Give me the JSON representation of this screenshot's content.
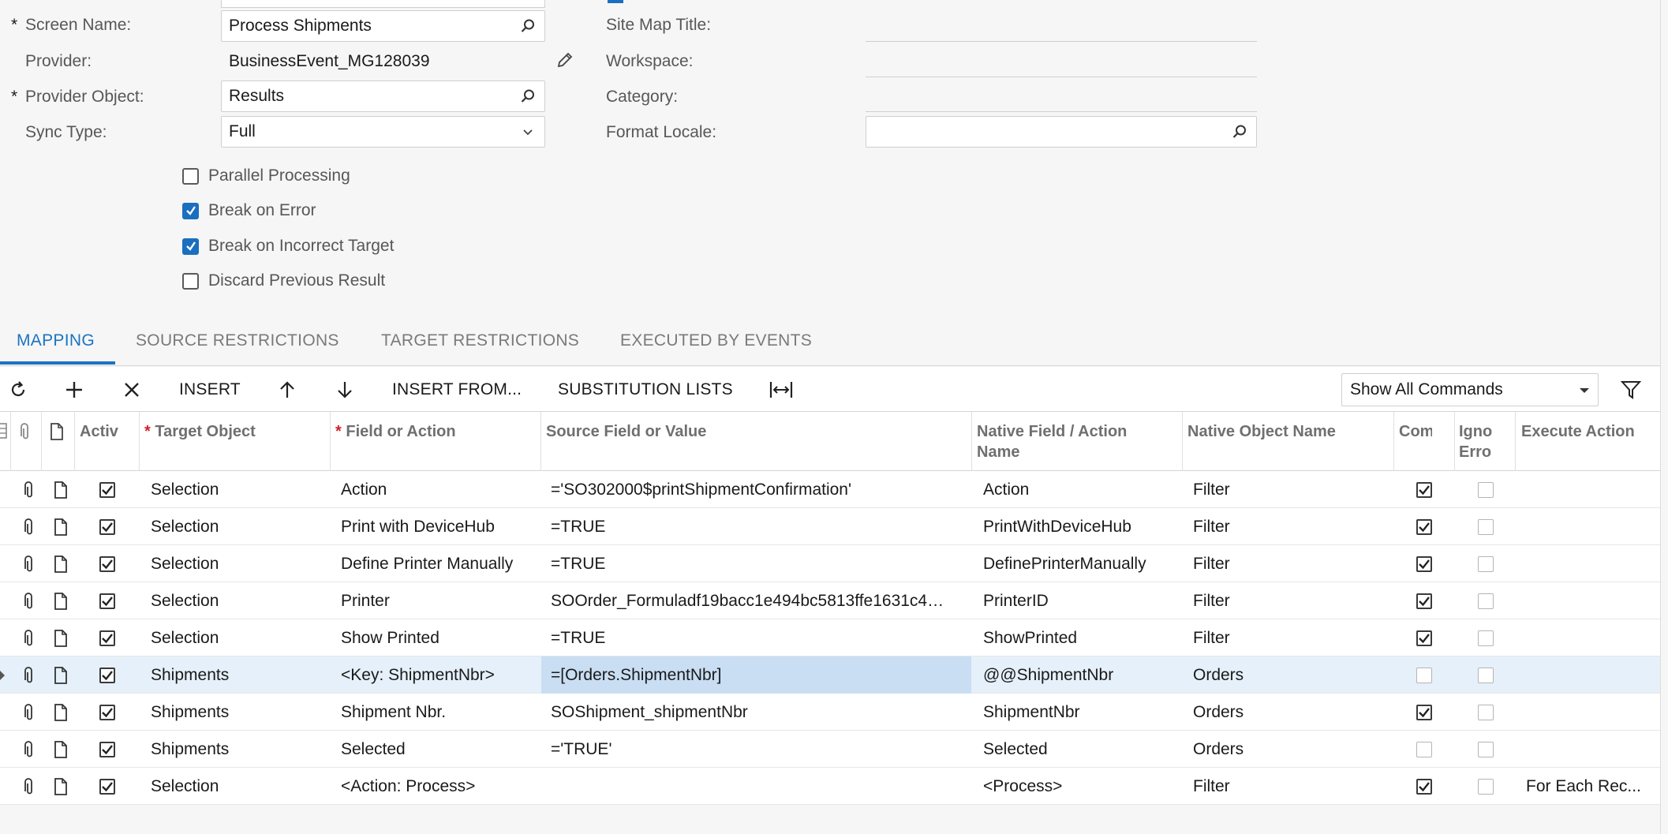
{
  "form": {
    "screen_name_label": "Screen Name:",
    "screen_name_value": "Process Shipments",
    "provider_label": "Provider:",
    "provider_value": "BusinessEvent_MG128039",
    "provider_object_label": "Provider Object:",
    "provider_object_value": "Results",
    "sync_type_label": "Sync Type:",
    "sync_type_value": "Full",
    "site_map_title_label": "Site Map Title:",
    "site_map_title_value": "",
    "workspace_label": "Workspace:",
    "workspace_value": "",
    "category_label": "Category:",
    "category_value": "",
    "format_locale_label": "Format Locale:",
    "format_locale_value": "",
    "required_marker": "*",
    "checkboxes": [
      {
        "label": "Parallel Processing",
        "checked": false
      },
      {
        "label": "Break on Error",
        "checked": true
      },
      {
        "label": "Break on Incorrect Target",
        "checked": true
      },
      {
        "label": "Discard Previous Result",
        "checked": false
      }
    ]
  },
  "tabs": [
    "MAPPING",
    "SOURCE RESTRICTIONS",
    "TARGET RESTRICTIONS",
    "EXECUTED BY EVENTS"
  ],
  "toolbar": {
    "insert": "INSERT",
    "insert_from": "INSERT FROM...",
    "substitution_lists": "SUBSTITUTION LISTS",
    "commands_select": "Show All Commands"
  },
  "grid": {
    "headers": {
      "active": "Activ",
      "target_object": "Target Object",
      "field_or_action": "Field or Action",
      "source_field": "Source Field or Value",
      "native_field": "Native Field / Action Name",
      "native_object": "Native Object Name",
      "commit": "Com",
      "ignore_error": "Igno Erro",
      "execute_action": "Execute Action"
    },
    "rows": [
      {
        "active": true,
        "target": "Selection",
        "field": "Action",
        "source": "='SO302000$printShipmentConfirmation'",
        "native_field": "Action",
        "native_object": "Filter",
        "commit": true,
        "ignore": false,
        "execute": ""
      },
      {
        "active": true,
        "target": "Selection",
        "field": "Print with DeviceHub",
        "source": "=TRUE",
        "native_field": "PrintWithDeviceHub",
        "native_object": "Filter",
        "commit": true,
        "ignore": false,
        "execute": ""
      },
      {
        "active": true,
        "target": "Selection",
        "field": "Define Printer Manually",
        "source": "=TRUE",
        "native_field": "DefinePrinterManually",
        "native_object": "Filter",
        "commit": true,
        "ignore": false,
        "execute": ""
      },
      {
        "active": true,
        "target": "Selection",
        "field": "Printer",
        "source": "SOOrder_Formuladf19bacc1e494bc5813ffe1631c4…",
        "native_field": "PrinterID",
        "native_object": "Filter",
        "commit": true,
        "ignore": false,
        "execute": ""
      },
      {
        "active": true,
        "target": "Selection",
        "field": "Show Printed",
        "source": "=TRUE",
        "native_field": "ShowPrinted",
        "native_object": "Filter",
        "commit": true,
        "ignore": false,
        "execute": ""
      },
      {
        "active": true,
        "target": "Shipments",
        "field": "<Key: ShipmentNbr>",
        "source": "=[Orders.ShipmentNbr]",
        "native_field": "@@ShipmentNbr",
        "native_object": "Orders",
        "commit": false,
        "ignore": false,
        "execute": ""
      },
      {
        "active": true,
        "target": "Shipments",
        "field": "Shipment Nbr.",
        "source": "SOShipment_shipmentNbr",
        "native_field": "ShipmentNbr",
        "native_object": "Orders",
        "commit": true,
        "ignore": false,
        "execute": ""
      },
      {
        "active": true,
        "target": "Shipments",
        "field": "Selected",
        "source": "='TRUE'",
        "native_field": "Selected",
        "native_object": "Orders",
        "commit": false,
        "ignore": false,
        "execute": ""
      },
      {
        "active": true,
        "target": "Selection",
        "field": "<Action: Process>",
        "source": "",
        "native_field": "<Process>",
        "native_object": "Filter",
        "commit": true,
        "ignore": false,
        "execute": "For Each Rec..."
      }
    ],
    "selected_row": 5
  },
  "colors": {
    "accent": "#1a74c4",
    "checkbox_on": "#1a6fbf",
    "required": "#d3202a",
    "selected_row": "#e5f0fa",
    "selected_cell": "#c9def3"
  }
}
